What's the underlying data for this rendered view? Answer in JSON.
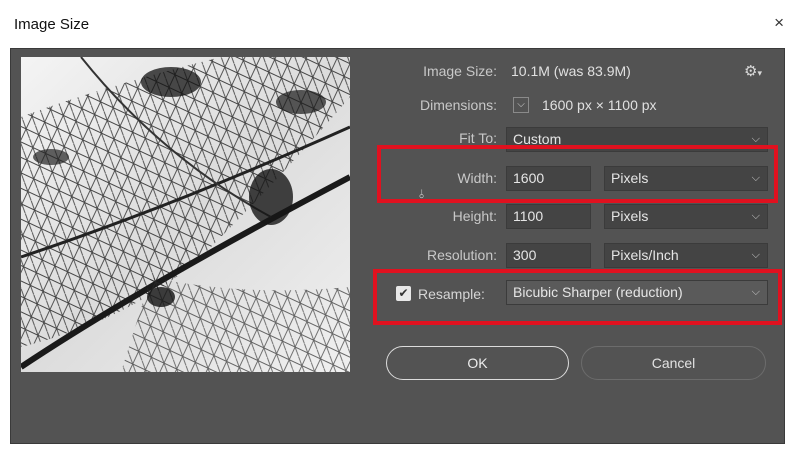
{
  "window": {
    "title": "Image Size",
    "close_glyph": "×"
  },
  "info": {
    "image_size_label": "Image Size:",
    "image_size_value": "10.1M (was 83.9M)",
    "dimensions_label": "Dimensions:",
    "dimensions_value": "1600 px  ×  1100 px",
    "fit_to_label": "Fit To:",
    "fit_to_value": "Custom"
  },
  "fields": {
    "width_label": "Width:",
    "width_value": "1600",
    "width_unit": "Pixels",
    "height_label": "Height:",
    "height_value": "1100",
    "height_unit": "Pixels",
    "resolution_label": "Resolution:",
    "resolution_value": "300",
    "resolution_unit": "Pixels/Inch"
  },
  "resample": {
    "label": "Resample:",
    "checked": true,
    "value": "Bicubic Sharper (reduction)"
  },
  "buttons": {
    "ok": "OK",
    "cancel": "Cancel"
  },
  "icons": {
    "gear": "gear-icon",
    "chevron": "chevron-down-icon",
    "link": "link-icon",
    "check": "checkbox-check-icon"
  },
  "colors": {
    "dialog_bg": "#535353",
    "field_bg": "#444444",
    "highlight": "#e0111f"
  }
}
